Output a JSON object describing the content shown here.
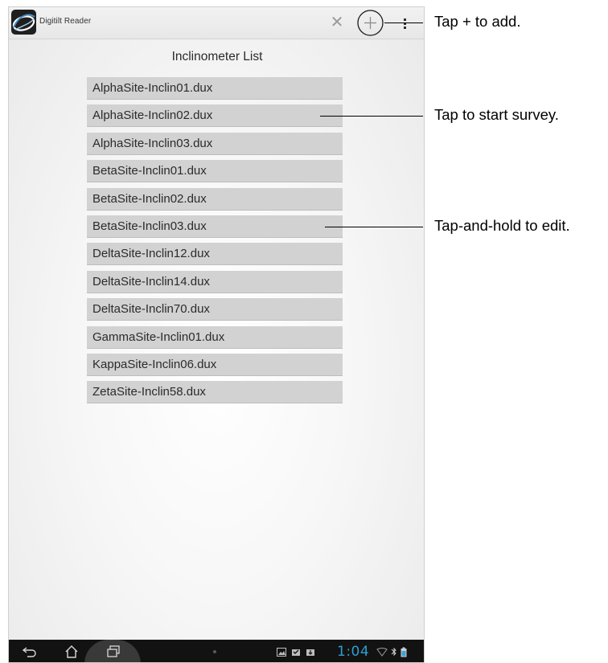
{
  "app": {
    "title": "Digitilt Reader",
    "logo_icon": "digitilt-logo-icon",
    "close_icon": "close-icon",
    "add_icon": "plus-icon",
    "menu_icon": "overflow-menu-icon"
  },
  "list": {
    "title": "Inclinometer List",
    "items": [
      "AlphaSite-Inclin01.dux",
      "AlphaSite-Inclin02.dux",
      "AlphaSite-Inclin03.dux",
      "BetaSite-Inclin01.dux",
      "BetaSite-Inclin02.dux",
      "BetaSite-Inclin03.dux",
      "DeltaSite-Inclin12.dux",
      "DeltaSite-Inclin14.dux",
      "DeltaSite-Inclin70.dux",
      "GammaSite-Inclin01.dux",
      "KappaSite-Inclin06.dux",
      "ZetaSite-Inclin58.dux"
    ]
  },
  "navbar": {
    "back_icon": "back-icon",
    "home_icon": "home-icon",
    "recents_icon": "recent-apps-icon",
    "clock": "1:04",
    "status_icons": [
      "gallery-icon",
      "shopping-bag-icon",
      "download-icon",
      "wifi-icon",
      "bluetooth-icon",
      "battery-icon"
    ]
  },
  "annotations": {
    "add": "Tap + to add.",
    "survey": "Tap to start survey.",
    "edit": "Tap-and-hold to edit."
  },
  "colors": {
    "list_item_bg": "#d2d2d2",
    "navbar_bg": "#121212",
    "clock": "#2c9fd0"
  }
}
